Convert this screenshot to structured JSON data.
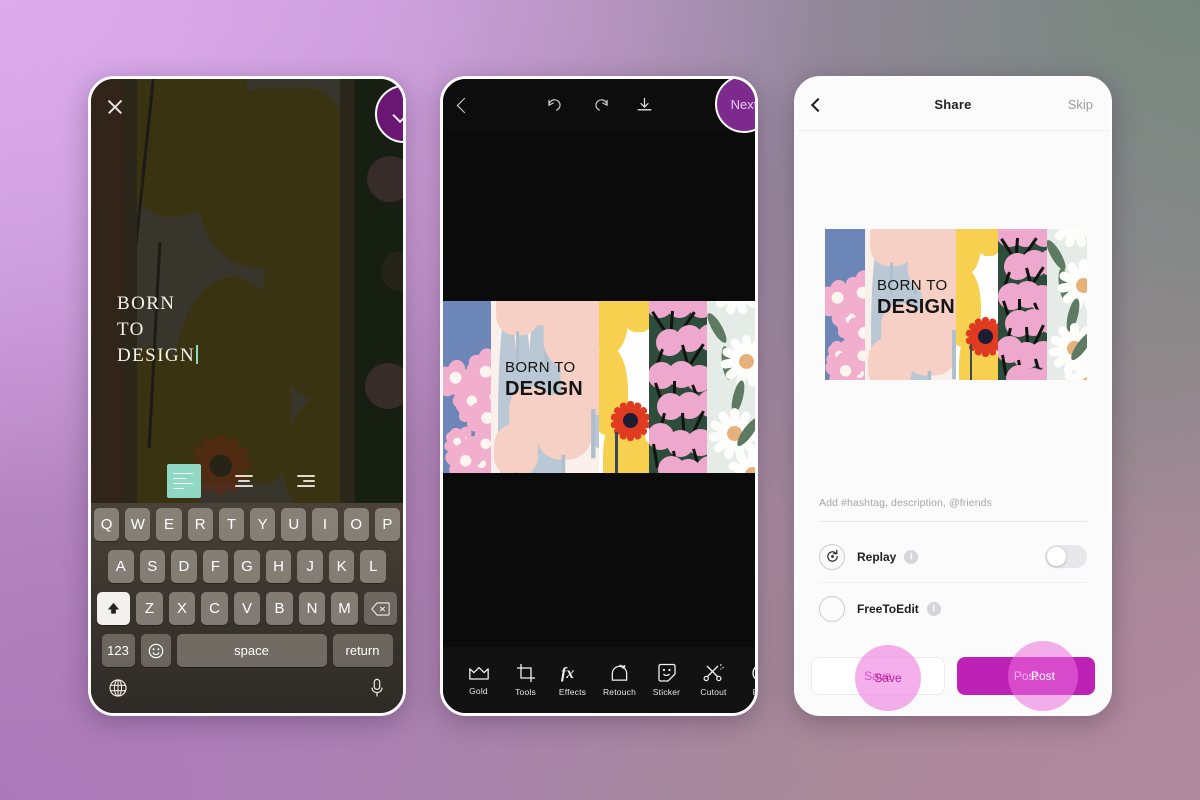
{
  "background": {
    "colors": [
      "#dcabeb",
      "#ab79b8",
      "#75877c",
      "#b0889b"
    ]
  },
  "artwork": {
    "headline_line1": "BORN TO",
    "headline_line2": "DESIGN",
    "panels": [
      "blue-blossoms",
      "cream-tulips",
      "yellow-sunflower",
      "green-berries",
      "white-daisies"
    ]
  },
  "phone1": {
    "close_label": "✕",
    "confirm_label": "✓",
    "text_value": "BORN\nTO\nDESIGN",
    "align": {
      "selected": "left",
      "options": [
        "left",
        "center",
        "right"
      ]
    },
    "keyboard": {
      "row1": [
        "Q",
        "W",
        "E",
        "R",
        "T",
        "Y",
        "U",
        "I",
        "O",
        "P"
      ],
      "row2": [
        "A",
        "S",
        "D",
        "F",
        "G",
        "H",
        "J",
        "K",
        "L"
      ],
      "row3": [
        "Z",
        "X",
        "C",
        "V",
        "B",
        "N",
        "M"
      ],
      "shift_label": "⇧",
      "delete_label": "⌫",
      "numbers_label": "123",
      "emoji_label": "☺",
      "space_label": "space",
      "return_label": "return",
      "globe_label": "⊕",
      "mic_label": "•"
    }
  },
  "phone2": {
    "back_label": "back",
    "undo_label": "undo",
    "redo_label": "redo",
    "download_label": "download",
    "next_label": "Next",
    "tools": [
      {
        "label": "Gold",
        "icon": "crown-icon"
      },
      {
        "label": "Tools",
        "icon": "crop-icon"
      },
      {
        "label": "Effects",
        "icon": "fx-icon"
      },
      {
        "label": "Retouch",
        "icon": "retouch-icon"
      },
      {
        "label": "Sticker",
        "icon": "sticker-icon"
      },
      {
        "label": "Cutout",
        "icon": "cutout-icon"
      },
      {
        "label": "Rec",
        "icon": "recent-icon"
      }
    ]
  },
  "phone3": {
    "title": "Share",
    "skip_label": "Skip",
    "hashtag_placeholder": "Add #hashtag, description, @friends",
    "replay": {
      "label": "Replay",
      "info": "i",
      "enabled": false
    },
    "freetoedit": {
      "label": "FreeToEdit",
      "info": "i",
      "enabled": false
    },
    "save_label": "Save",
    "post_label": "Post",
    "accent_post": "#bd21b5",
    "accent_save_text": "#c2289a"
  }
}
